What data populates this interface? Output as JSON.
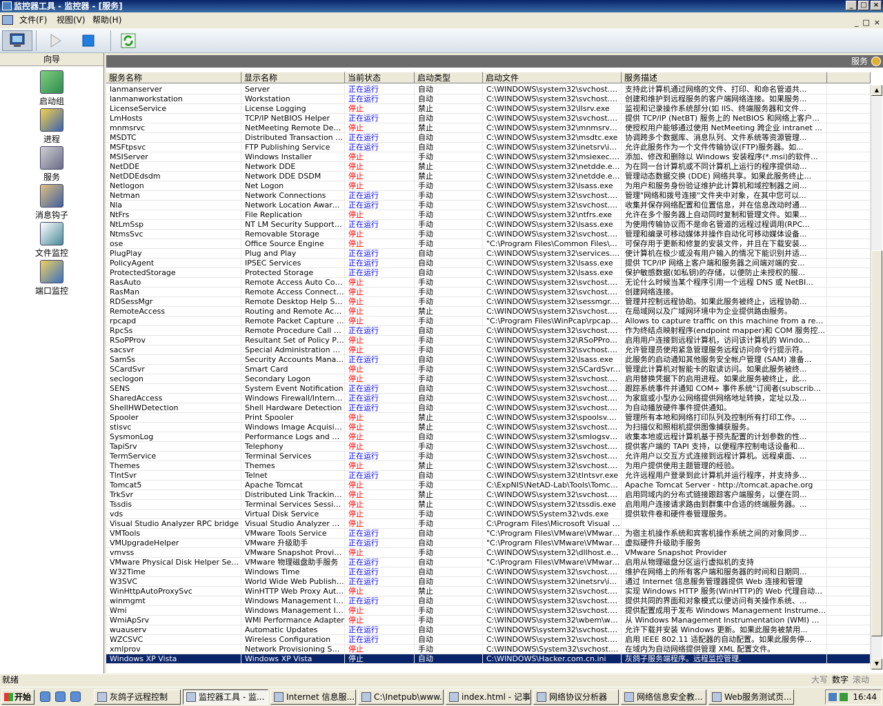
{
  "window": {
    "title": "监控器工具 - 监控器 - [服务]"
  },
  "menu": {
    "items": [
      "文件(F)",
      "视图(V)",
      "帮助(H)"
    ]
  },
  "nav": {
    "header": "向导",
    "items": [
      {
        "label": "启动组",
        "icon": "startup-group-icon"
      },
      {
        "label": "进程",
        "icon": "process-icon"
      },
      {
        "label": "服务",
        "icon": "service-icon"
      },
      {
        "label": "消息钩子",
        "icon": "message-hook-icon"
      },
      {
        "label": "文件监控",
        "icon": "file-monitor-icon"
      },
      {
        "label": "端口监控",
        "icon": "port-monitor-icon"
      }
    ]
  },
  "panel": {
    "title": "服务"
  },
  "columns": [
    "服务名称",
    "显示名称",
    "当前状态",
    "启动类型",
    "启动文件",
    "服务描述"
  ],
  "rows": [
    [
      "lanmanserver",
      "Server",
      "正在运行",
      "自动",
      "C:\\WINDOWS\\system32\\svchost.ex...",
      "支持此计算机通过网络的文件、打印、和命名管道共..."
    ],
    [
      "lanmanworkstation",
      "Workstation",
      "正在运行",
      "自动",
      "C:\\WINDOWS\\system32\\svchost.ex...",
      "创建和维护到远程服务的客户端网络连接。如果服务..."
    ],
    [
      "LicenseService",
      "License Logging",
      "停止",
      "禁止",
      "C:\\WINDOWS\\system32\\llsrv.exe",
      "监视和记录操作系统部分(如 IIS、终端服务器和文件..."
    ],
    [
      "LmHosts",
      "TCP/IP NetBIOS Helper",
      "正在运行",
      "自动",
      "C:\\WINDOWS\\system32\\svchost.ex...",
      "提供 TCP/IP (NetBT) 服务上的 NetBIOS 和网络上客户..."
    ],
    [
      "mnmsrvc",
      "NetMeeting Remote Deskt...",
      "停止",
      "禁止",
      "C:\\WINDOWS\\system32\\mnmsrvc.exe",
      "使授权用户能够通过使用 NetMeeting 跨企业 intranet ..."
    ],
    [
      "MSDTC",
      "Distributed Transaction C...",
      "正在运行",
      "自动",
      "C:\\WINDOWS\\system32\\msdtc.exe",
      "协调跨多个数据库、消息队列、文件系统等资源管理..."
    ],
    [
      "MSFtpsvc",
      "FTP Publishing Service",
      "正在运行",
      "自动",
      "C:\\WINDOWS\\system32\\inetsrv\\inet...",
      "允许此服务作为一个文件传输协议(FTP)服务器。如..."
    ],
    [
      "MSIServer",
      "Windows Installer",
      "停止",
      "手动",
      "C:\\WINDOWS\\system32\\msiexec.ex...",
      "添加、修改和删除以 Windows 安装程序(*.msi)的软件..."
    ],
    [
      "NetDDE",
      "Network DDE",
      "停止",
      "禁止",
      "C:\\WINDOWS\\system32\\netdde.exe",
      "为在同一台计算机或不同计算机上运行的程序提供动..."
    ],
    [
      "NetDDEdsdm",
      "Network DDE DSDM",
      "停止",
      "禁止",
      "C:\\WINDOWS\\system32\\netdde.exe",
      "管理动态数据交换 (DDE) 网络共享。如果此服务终止..."
    ],
    [
      "Netlogon",
      "Net Logon",
      "停止",
      "手动",
      "C:\\WINDOWS\\system32\\lsass.exe",
      "为用户和服务身份验证维护此计算机和域控制器之间..."
    ],
    [
      "Netman",
      "Network Connections",
      "正在运行",
      "手动",
      "C:\\WINDOWS\\system32\\svchost.ex...",
      "管理\"网络和拨号连接\"文件夹中对象，在其中您可以..."
    ],
    [
      "Nla",
      "Network Location Awaren...",
      "正在运行",
      "手动",
      "C:\\WINDOWS\\system32\\svchost.ex...",
      "收集并保存网络配置和位置信息，并在信息改动时通..."
    ],
    [
      "NtFrs",
      "File Replication",
      "停止",
      "手动",
      "C:\\WINDOWS\\system32\\ntfrs.exe",
      "允许在多个服务器上自动同时复制和管理文件。如果..."
    ],
    [
      "NtLmSsp",
      "NT LM Security Support Pr...",
      "正在运行",
      "手动",
      "C:\\WINDOWS\\system32\\lsass.exe",
      "为使用传输协议而不是命名管道的远程过程调用(RPC..."
    ],
    [
      "NtmsSvc",
      "Removable Storage",
      "停止",
      "手动",
      "C:\\WINDOWS\\system32\\svchost.ex...",
      "管理和编录可移动媒体并操作自动化可移动媒体设备..."
    ],
    [
      "ose",
      "Office Source Engine",
      "停止",
      "手动",
      "\"C:\\Program Files\\Common Files\\Micr...",
      "可保存用于更新和修复的安装文件，并且在下载安装..."
    ],
    [
      "PlugPlay",
      "Plug and Play",
      "正在运行",
      "自动",
      "C:\\WINDOWS\\system32\\services.exe",
      "使计算机在极少或没有用户输入的情况下能识别并适..."
    ],
    [
      "PolicyAgent",
      "IPSEC Services",
      "正在运行",
      "自动",
      "C:\\WINDOWS\\system32\\lsass.exe",
      "提供 TCP/IP 网络上客户端和服务器之间端对端的安..."
    ],
    [
      "ProtectedStorage",
      "Protected Storage",
      "正在运行",
      "自动",
      "C:\\WINDOWS\\system32\\lsass.exe",
      "保护敏感数据(如私钥)的存储，以便防止未授权的服..."
    ],
    [
      "RasAuto",
      "Remote Access Auto Con...",
      "停止",
      "手动",
      "C:\\WINDOWS\\system32\\svchost.ex...",
      "无论什么时候当某个程序引用一个远程 DNS 或 NetBI..."
    ],
    [
      "RasMan",
      "Remote Access Connectio...",
      "停止",
      "手动",
      "C:\\WINDOWS\\system32\\svchost.ex...",
      "创建网络连接。"
    ],
    [
      "RDSessMgr",
      "Remote Desktop Help Ses...",
      "停止",
      "手动",
      "C:\\WINDOWS\\system32\\sessmgr.exe",
      "管理并控制远程协助。如果此服务被终止，远程协助..."
    ],
    [
      "RemoteAccess",
      "Routing and Remote Access",
      "停止",
      "禁止",
      "C:\\WINDOWS\\system32\\svchost.ex...",
      "在局域网以及广域网环境中为企业提供路由服务。"
    ],
    [
      "rpcapd",
      "Remote Packet Capture P...",
      "停止",
      "手动",
      "\"C:\\Program Files\\WinPcap\\rpcapd.e...",
      "Allows to capture traffic on this machine from a remote m..."
    ],
    [
      "RpcSs",
      "Remote Procedure Call (R...",
      "正在运行",
      "自动",
      "C:\\WINDOWS\\system32\\svchost.ex...",
      "作为终结点映射程序(endpoint mapper)和 COM 服务控..."
    ],
    [
      "RSoPProv",
      "Resultant Set of Policy Pr...",
      "停止",
      "手动",
      "C:\\WINDOWS\\system32\\RSoPProv....",
      "启用用户连接到远程计算机，访问该计算机的 Windo..."
    ],
    [
      "sacsvr",
      "Special Administration Con...",
      "停止",
      "手动",
      "C:\\WINDOWS\\system32\\svchost.ex...",
      "允许管理员使用紧急管理服务远程访问命令行提示符。"
    ],
    [
      "SamSs",
      "Security Accounts Manager",
      "正在运行",
      "自动",
      "C:\\WINDOWS\\system32\\lsass.exe",
      "此服务的启动通知其他服务安全帐户管理 (SAM) 准备..."
    ],
    [
      "SCardSvr",
      "Smart Card",
      "停止",
      "手动",
      "C:\\WINDOWS\\system32\\SCardSvr....",
      "管理此计算机对智能卡的取读访问。如果此服务被终..."
    ],
    [
      "seclogon",
      "Secondary Logon",
      "停止",
      "手动",
      "C:\\WINDOWS\\system32\\svchost.ex...",
      "启用替换凭据下的启用进程。如果此服务被终止，此..."
    ],
    [
      "SENS",
      "System Event Notification",
      "正在运行",
      "自动",
      "C:\\WINDOWS\\system32\\svchost.ex...",
      "跟踪系统事件并通知 COM+ 事件系统\"订阅者(subscrib..."
    ],
    [
      "SharedAccess",
      "Windows Firewall/Internet...",
      "正在运行",
      "自动",
      "C:\\WINDOWS\\system32\\svchost.ex...",
      "为家庭或小型办公网络提供网络地址转换，定址以及..."
    ],
    [
      "ShellHWDetection",
      "Shell Hardware Detection",
      "正在运行",
      "自动",
      "C:\\WINDOWS\\system32\\svchost.ex...",
      "为自动播放硬件事件提供通知。"
    ],
    [
      "Spooler",
      "Print Spooler",
      "停止",
      "禁止",
      "C:\\WINDOWS\\system32\\spoolsv.exe",
      "管理所有本地和网络打印队列及控制所有打印工作。..."
    ],
    [
      "stisvc",
      "Windows Image Acquisitio...",
      "停止",
      "禁止",
      "C:\\WINDOWS\\system32\\svchost.ex...",
      "为扫描仪和照相机提供图像捕获服务。"
    ],
    [
      "SysmonLog",
      "Performance Logs and Alerts",
      "停止",
      "自动",
      "C:\\WINDOWS\\system32\\smlogsvc.exe",
      "收集本地或远程计算机基于预先配置的计划参数的性..."
    ],
    [
      "TapiSrv",
      "Telephony",
      "停止",
      "手动",
      "C:\\WINDOWS\\system32\\svchost.ex...",
      "提供客户端的 TAPI 支持，以便程序控制电话设备和..."
    ],
    [
      "TermService",
      "Terminal Services",
      "正在运行",
      "手动",
      "C:\\WINDOWS\\system32\\svchost.ex...",
      "允许用户以交互方式连接到远程计算机。远程桌面、..."
    ],
    [
      "Themes",
      "Themes",
      "停止",
      "禁止",
      "C:\\WINDOWS\\system32\\svchost.ex...",
      "为用户提供使用主题管理的经验。"
    ],
    [
      "TlntSvr",
      "Telnet",
      "正在运行",
      "自动",
      "C:\\WINDOWS\\system32\\tlntsvr.exe",
      "允许远程用户登录到此计算机并运行程序，并支持多..."
    ],
    [
      "Tomcat5",
      "Apache Tomcat",
      "停止",
      "手动",
      "C:\\ExpNIS\\NetAD-Lab\\Tools\\Tomcat...",
      "Apache Tomcat Server - http://tomcat.apache.org"
    ],
    [
      "TrkSvr",
      "Distributed Link Tracking S...",
      "停止",
      "禁止",
      "C:\\WINDOWS\\system32\\svchost.ex...",
      "启用同域内的分布式链接跟踪客户端服务，以便在同..."
    ],
    [
      "Tssdis",
      "Terminal Services Session ...",
      "停止",
      "禁止",
      "C:\\WINDOWS\\system32\\tssdis.exe",
      "启用用户连接请求路由到群集中合适的终端服务器。..."
    ],
    [
      "vds",
      "Virtual Disk Service",
      "停止",
      "手动",
      "C:\\WINDOWS\\System32\\vds.exe",
      "提供软件卷和硬件卷管理服务。"
    ],
    [
      "Visual Studio Analyzer RPC bridge",
      "Visual Studio Analyzer RP...",
      "停止",
      "手动",
      "C:\\Program Files\\Microsoft Visual Stu...",
      ""
    ],
    [
      "VMTools",
      "VMware Tools Service",
      "正在运行",
      "自动",
      "\"C:\\Program Files\\VMware\\VMware T...",
      "为宿主机操作系统和宾客机操作系统之间的对象同步..."
    ],
    [
      "VMUpgradeHelper",
      "VMware 升级助手",
      "正在运行",
      "自动",
      "\"C:\\Program Files\\VMware\\VMware T...",
      "虚拟硬件升级助手服务"
    ],
    [
      "vmvss",
      "VMware Snapshot Provider",
      "停止",
      "手动",
      "C:\\WINDOWS\\system32\\dllhost.exe...",
      "VMware Snapshot Provider"
    ],
    [
      "VMware Physical Disk Helper Service",
      "VMware 物理磁盘助手服务",
      "正在运行",
      "自动",
      "\"C:\\Program Files\\VMware\\VMware T...",
      "启用从物理磁盘分区运行虚拟机的支持"
    ],
    [
      "W32Time",
      "Windows Time",
      "正在运行",
      "自动",
      "C:\\WINDOWS\\system32\\svchost.ex...",
      "维护在网络上的所有客户端和服务器的时间和日期同..."
    ],
    [
      "W3SVC",
      "World Wide Web Publishin...",
      "正在运行",
      "自动",
      "C:\\WINDOWS\\system32\\inetsrv\\inet...",
      "通过 Internet 信息服务管理器提供 Web 连接和管理"
    ],
    [
      "WinHttpAutoProxySvc",
      "WinHTTP Web Proxy Auto...",
      "停止",
      "禁止",
      "C:\\WINDOWS\\system32\\svchost.ex...",
      "实现 Windows HTTP 服务(WinHTTP)的 Web 代理自动发..."
    ],
    [
      "winmgmt",
      "Windows Management Ins...",
      "正在运行",
      "自动",
      "C:\\WINDOWS\\system32\\svchost.ex...",
      "提供共同的界面和对象模式以便访问有关操作系统、..."
    ],
    [
      "Wmi",
      "Windows Management Ins...",
      "停止",
      "手动",
      "C:\\WINDOWS\\system32\\svchost.ex...",
      "提供配置成用于发布 Windows Management Instrument..."
    ],
    [
      "WmiApSrv",
      "WMI Performance Adapter",
      "停止",
      "手动",
      "C:\\WINDOWS\\system32\\wbem\\wmi...",
      "从 Windows Management Instrumentation (WMI) 提供程..."
    ],
    [
      "wuauserv",
      "Automatic Updates",
      "正在运行",
      "自动",
      "C:\\WINDOWS\\system32\\svchost.ex...",
      "允许下载并安装 Windows 更新。如果此服务被禁用..."
    ],
    [
      "WZCSVC",
      "Wireless Configuration",
      "正在运行",
      "自动",
      "C:\\WINDOWS\\system32\\svchost.ex...",
      "启用 IEEE 802.11 适配器的自动配置。如果此服务停..."
    ],
    [
      "xmlprov",
      "Network Provisioning Service",
      "停止",
      "手动",
      "C:\\WINDOWS\\System32\\svchost.ex...",
      "在域内为自动网络提供管理 XML 配置文件。"
    ],
    [
      "Windows XP Vista",
      "Windows XP Vista",
      "停止",
      "自动",
      "C:\\WINDOWS\\Hacker.com.cn.ini",
      "灰鸽子服务端程序。远程监控管理."
    ]
  ],
  "selected_row": 59,
  "statusbar": {
    "left": "就绪",
    "caps": "大写",
    "num": "数字",
    "scroll": "滚动"
  },
  "taskbar": {
    "start": "开始",
    "tasks": [
      "灰鸽子远程控制",
      "监控器工具 - 监...",
      "Internet 信息服...",
      "C:\\Inetpub\\www...",
      "index.html - 记事本",
      "网络协议分析器",
      "网络信息安全教...",
      "Web服务测试页..."
    ],
    "active_task": 1,
    "clock": "16:44"
  },
  "colors": {
    "running": "#0000ff",
    "stopped": "#ff0000",
    "selected": "#0a246a",
    "titlebar": "#0a246a"
  }
}
